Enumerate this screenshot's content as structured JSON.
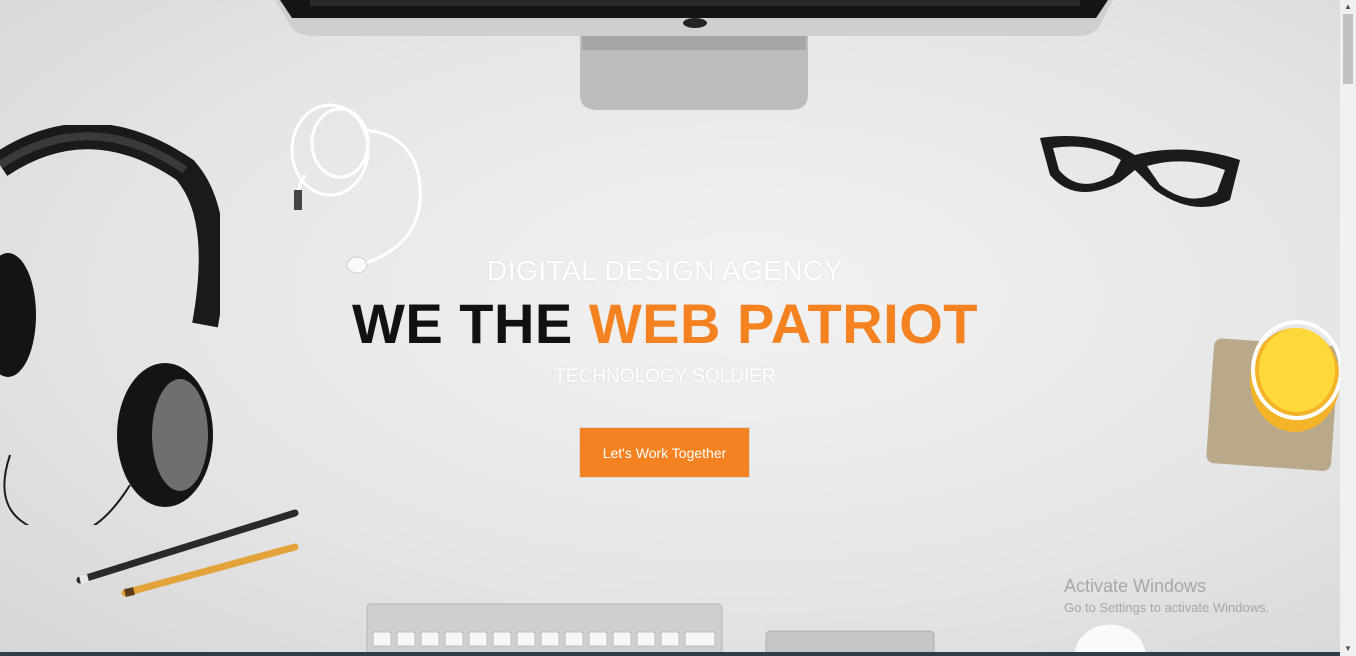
{
  "hero": {
    "subtitle": "DIGITAL DESIGN AGENCY",
    "headline_dark": "WE THE ",
    "headline_accent": "WEB PATRIOT",
    "tagline": "TECHNOLOGY SOLDIER",
    "cta_label": "Let's Work Together"
  },
  "watermark": {
    "line1": "Activate Windows",
    "line2": "Go to Settings to activate Windows."
  },
  "colors": {
    "accent": "#f58220",
    "headline": "#111111",
    "background": "#e6e6e6"
  },
  "icons": [
    "imac-image",
    "earphones-image",
    "headphones-image",
    "glasses-image",
    "juice-glass-image",
    "pencils-image",
    "keyboard-image",
    "trackpad-image",
    "mouse-image"
  ]
}
